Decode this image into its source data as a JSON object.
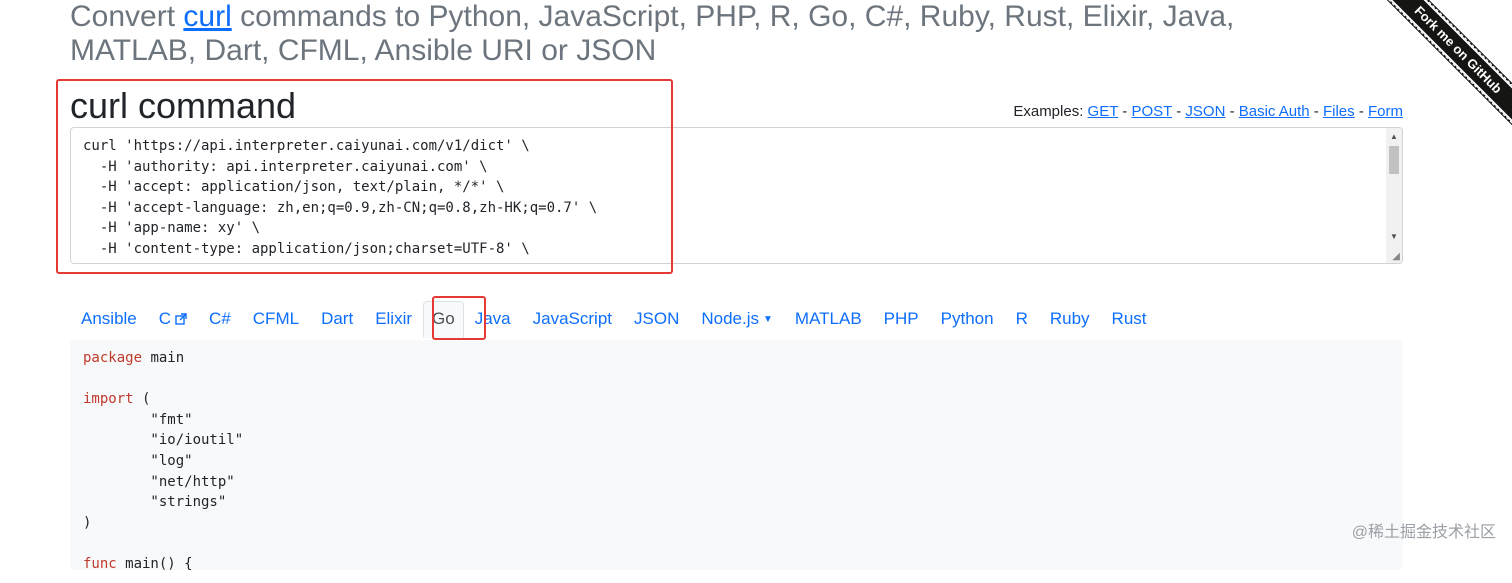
{
  "header": {
    "title_prefix": "Convert ",
    "title_link": "curl",
    "title_suffix": " commands to Python, JavaScript, PHP, R, Go, C#, Ruby, Rust, Elixir, Java, MATLAB, Dart, CFML, Ansible URI or JSON"
  },
  "ribbon": {
    "label": "Fork me on GitHub"
  },
  "curl_section": {
    "title": "curl command",
    "examples_label": "Examples:",
    "examples": [
      "GET",
      "POST",
      "JSON",
      "Basic Auth",
      "Files",
      "Form"
    ],
    "separator": "-",
    "command": "curl 'https://api.interpreter.caiyunai.com/v1/dict' \\\n  -H 'authority: api.interpreter.caiyunai.com' \\\n  -H 'accept: application/json, text/plain, */*' \\\n  -H 'accept-language: zh,en;q=0.9,zh-CN;q=0.8,zh-HK;q=0.7' \\\n  -H 'app-name: xy' \\\n  -H 'content-type: application/json;charset=UTF-8' \\\n  -H 'device-id: ' \\"
  },
  "tabs": [
    {
      "label": "Ansible"
    },
    {
      "label": "C",
      "external": true
    },
    {
      "label": "C#"
    },
    {
      "label": "CFML"
    },
    {
      "label": "Dart"
    },
    {
      "label": "Elixir"
    },
    {
      "label": "Go",
      "active": true
    },
    {
      "label": "Java"
    },
    {
      "label": "JavaScript"
    },
    {
      "label": "JSON"
    },
    {
      "label": "Node.js",
      "dropdown": true
    },
    {
      "label": "MATLAB"
    },
    {
      "label": "PHP"
    },
    {
      "label": "Python"
    },
    {
      "label": "R"
    },
    {
      "label": "Ruby"
    },
    {
      "label": "Rust"
    }
  ],
  "output": {
    "lines": [
      {
        "kw": "package",
        "rest": " main"
      },
      {
        "kw": "",
        "rest": ""
      },
      {
        "kw": "import",
        "rest": " ("
      },
      {
        "kw": "",
        "rest": "        \"fmt\""
      },
      {
        "kw": "",
        "rest": "        \"io/ioutil\""
      },
      {
        "kw": "",
        "rest": "        \"log\""
      },
      {
        "kw": "",
        "rest": "        \"net/http\""
      },
      {
        "kw": "",
        "rest": "        \"strings\""
      },
      {
        "kw": "",
        "rest": ")"
      },
      {
        "kw": "",
        "rest": ""
      },
      {
        "kw": "func",
        "rest": " main() {"
      }
    ]
  },
  "watermark": "@稀土掘金技术社区",
  "colors": {
    "link": "#0d6efd",
    "highlight": "#e53935",
    "keyword": "#c0392b"
  }
}
